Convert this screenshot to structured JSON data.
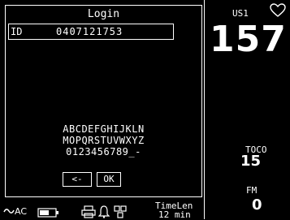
{
  "login": {
    "title": "Login",
    "id_label": "ID",
    "id_value": "0407121753",
    "keyboard_rows": [
      "ABCDEFGHIJKLN",
      "MOPQRSTUVWXYZ",
      "0123456789_-"
    ],
    "back_button": "<-",
    "ok_button": "OK"
  },
  "monitor": {
    "us1_label": "US1",
    "heart_rate": "157",
    "toco_label": "TOCO",
    "toco_value": "15",
    "fm_label": "FM",
    "fm_value": "0"
  },
  "status": {
    "ac_label": "AC",
    "timelen_label": "TimeLen",
    "timelen_value": "12 min"
  },
  "icons": [
    "heart-icon",
    "ac-icon",
    "battery-icon",
    "printer-icon",
    "bell-icon",
    "network-icon"
  ]
}
